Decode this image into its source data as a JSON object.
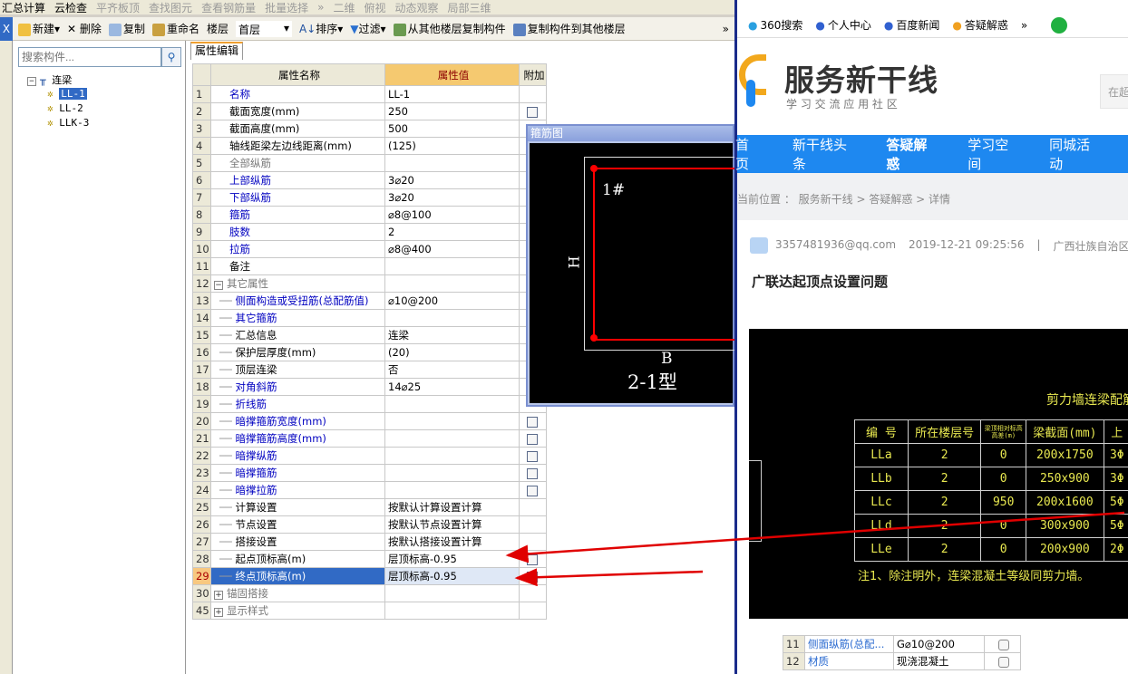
{
  "toolbar_top": {
    "items": [
      "汇总计算",
      "云检查",
      "平齐板顶",
      "查找图元",
      "查看钢筋量",
      "批量选择",
      "»",
      "二维",
      "俯视",
      "动态观察",
      "局部三维"
    ]
  },
  "toolbar": {
    "new": "新建",
    "delete": "删除",
    "copy": "复制",
    "rename": "重命名",
    "floor_label": "楼层",
    "floor_value": "首层",
    "sort": "排序",
    "filter": "过滤",
    "copy_from": "从其他楼层复制构件",
    "copy_to": "复制构件到其他楼层",
    "more": "»",
    "close": "X"
  },
  "search": {
    "placeholder": "搜索构件..."
  },
  "tree": {
    "root": "连梁",
    "items": [
      "LL-1",
      "LL-2",
      "LLK-3"
    ],
    "selected": "LL-1"
  },
  "tab": "属性编辑",
  "table": {
    "headers": [
      "属性名称",
      "属性值",
      "附加"
    ],
    "rows": [
      {
        "n": "1",
        "name": "名称",
        "value": "LL-1",
        "style": "blue",
        "cb": false
      },
      {
        "n": "2",
        "name": "截面宽度(mm)",
        "value": "250",
        "cb": true
      },
      {
        "n": "3",
        "name": "截面高度(mm)",
        "value": "500",
        "cb": true
      },
      {
        "n": "4",
        "name": "轴线距梁左边线距离(mm)",
        "value": "(125)",
        "cb": true
      },
      {
        "n": "5",
        "name": "全部纵筋",
        "value": "",
        "style": "gray"
      },
      {
        "n": "6",
        "name": "上部纵筋",
        "value": "3⌀20",
        "style": "blue"
      },
      {
        "n": "7",
        "name": "下部纵筋",
        "value": "3⌀20",
        "style": "blue"
      },
      {
        "n": "8",
        "name": "箍筋",
        "value": "⌀8@100",
        "style": "blue"
      },
      {
        "n": "9",
        "name": "肢数",
        "value": "2",
        "style": "blue"
      },
      {
        "n": "10",
        "name": "拉筋",
        "value": "⌀8@400",
        "style": "blue"
      },
      {
        "n": "11",
        "name": "备注",
        "value": ""
      },
      {
        "n": "12",
        "name": "其它属性",
        "value": "",
        "style": "gray",
        "group": "-"
      },
      {
        "n": "13",
        "name": "侧面构造或受扭筋(总配筋值)",
        "value": "⌀10@200",
        "style": "blue",
        "sub": true
      },
      {
        "n": "14",
        "name": "其它箍筋",
        "value": "",
        "style": "blue",
        "sub": true
      },
      {
        "n": "15",
        "name": "汇总信息",
        "value": "连梁",
        "sub": true
      },
      {
        "n": "16",
        "name": "保护层厚度(mm)",
        "value": "(20)",
        "sub": true
      },
      {
        "n": "17",
        "name": "顶层连梁",
        "value": "否",
        "sub": true
      },
      {
        "n": "18",
        "name": "对角斜筋",
        "value": "14⌀25",
        "style": "blue",
        "sub": true
      },
      {
        "n": "19",
        "name": "折线筋",
        "value": "",
        "style": "blue",
        "sub": true
      },
      {
        "n": "20",
        "name": "暗撑箍筋宽度(mm)",
        "value": "",
        "style": "blue",
        "sub": true,
        "cb": true
      },
      {
        "n": "21",
        "name": "暗撑箍筋高度(mm)",
        "value": "",
        "style": "blue",
        "sub": true,
        "cb": true
      },
      {
        "n": "22",
        "name": "暗撑纵筋",
        "value": "",
        "style": "blue",
        "sub": true,
        "cb": true
      },
      {
        "n": "23",
        "name": "暗撑箍筋",
        "value": "",
        "style": "blue",
        "sub": true,
        "cb": true
      },
      {
        "n": "24",
        "name": "暗撑拉筋",
        "value": "",
        "style": "blue",
        "sub": true,
        "cb": true
      },
      {
        "n": "25",
        "name": "计算设置",
        "value": "按默认计算设置计算",
        "sub": true
      },
      {
        "n": "26",
        "name": "节点设置",
        "value": "按默认节点设置计算",
        "sub": true
      },
      {
        "n": "27",
        "name": "搭接设置",
        "value": "按默认搭接设置计算",
        "sub": true
      },
      {
        "n": "28",
        "name": "起点顶标高(m)",
        "value": "层顶标高-0.95",
        "sub": true,
        "cb": true
      },
      {
        "n": "29",
        "name": "终点顶标高(m)",
        "value": "层顶标高-0.95",
        "sub": true,
        "cb": true,
        "selected": true
      },
      {
        "n": "30",
        "name": "锚固搭接",
        "value": "",
        "style": "gray",
        "group": "+"
      },
      {
        "n": "45",
        "name": "显示样式",
        "value": "",
        "style": "gray",
        "group": "+"
      }
    ]
  },
  "dialog": {
    "title": "箍筋图",
    "label_1": "1#",
    "label_h": "H",
    "label_b": "B",
    "type": "2-1型"
  },
  "browser": {
    "bookmarks": [
      "360搜索",
      "个人中心",
      "百度新闻",
      "答疑解惑",
      "»"
    ],
    "logo_title": "服务新干线",
    "logo_sub": "学 习 交 流 应 用 社 区",
    "search_hint": "在超",
    "nav": [
      "首页",
      "新干线头条",
      "答疑解惑",
      "学习空间",
      "同城活动"
    ],
    "nav_active": "答疑解惑",
    "breadcrumb": "当前位置 ： 服务新干线 > 答疑解惑 > 详情",
    "author": "3357481936@qq.com",
    "time": "2019-12-21 09:25:56",
    "sep": "|",
    "region": "广西壮族自治区",
    "question_title": "广联达起顶点设置问题",
    "cad": {
      "title": "剪力墙连梁配筋表",
      "headers": [
        "编 号",
        "所在楼层号",
        "梁顶相对标高高差(m)",
        "梁截面(mm)",
        "上"
      ],
      "rows": [
        [
          "LLa",
          "2",
          "0",
          "200x1750",
          "3Φ"
        ],
        [
          "LLb",
          "2",
          "0",
          "250x900",
          "3Φ"
        ],
        [
          "LLc",
          "2",
          "950",
          "200x1600",
          "5Φ"
        ],
        [
          "LLd",
          "2",
          "0",
          "300x900",
          "5Φ"
        ],
        [
          "LLe",
          "2",
          "0",
          "200x900",
          "2Φ"
        ]
      ],
      "note": "注1、除注明外，连梁混凝土等级同剪力墙。"
    },
    "mini_rows": [
      [
        "11",
        "侧面纵筋(总配...",
        "G⌀10@200"
      ],
      [
        "12",
        "材质",
        "现浇混凝土"
      ]
    ]
  },
  "colors": {
    "nav": "#1e88f0",
    "selection": "#316ac5",
    "arrow": "#e00000",
    "cad_text": "#e8e850"
  }
}
